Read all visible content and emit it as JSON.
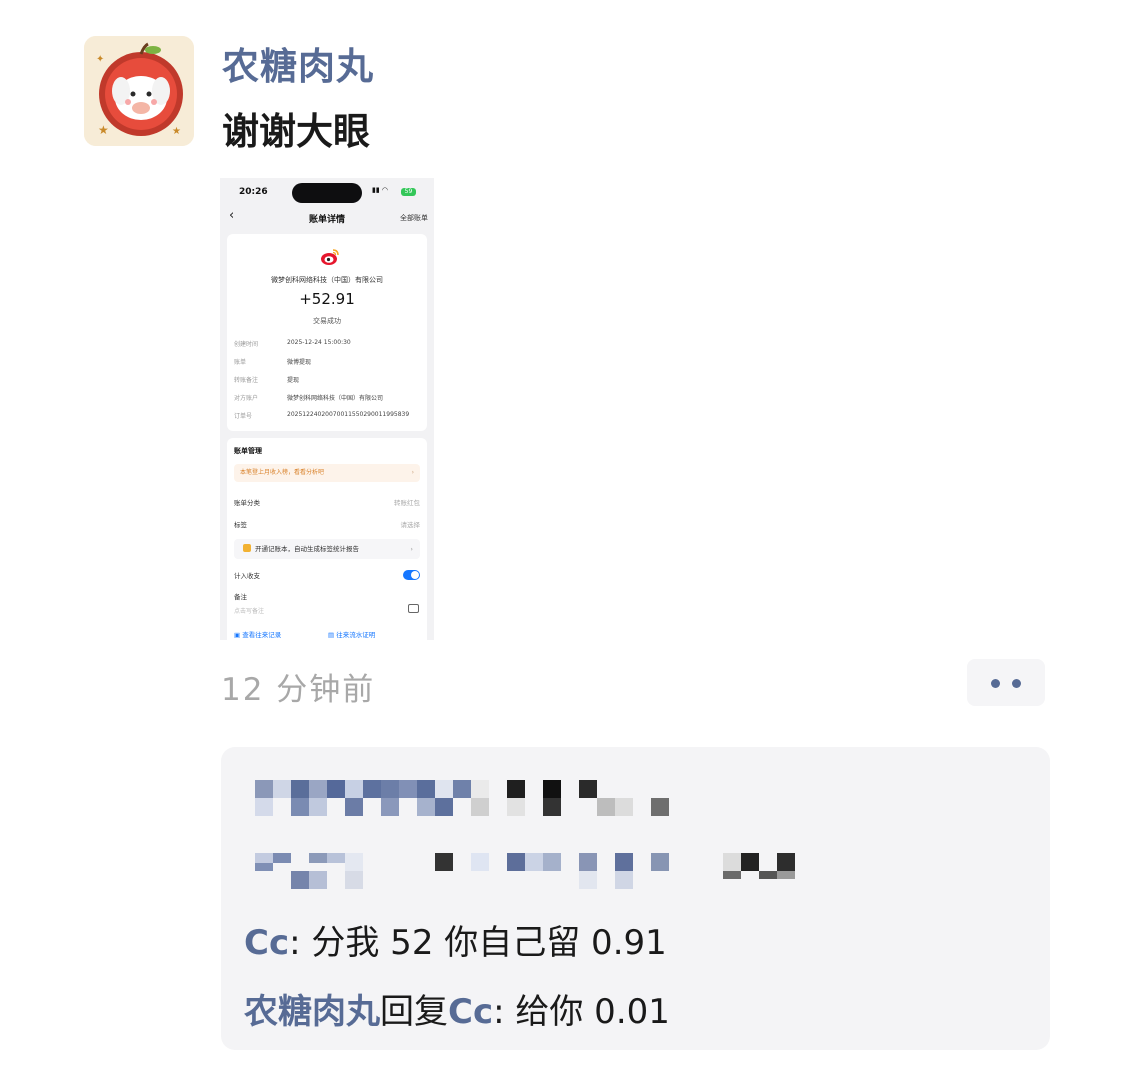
{
  "post": {
    "author": "农糖肉丸",
    "text": "谢谢大眼",
    "time": "12 分钟前"
  },
  "screenshot": {
    "status_time": "20:26",
    "battery": "59",
    "title": "账单详情",
    "right_link": "全部账单",
    "company": "微梦创科网络科技（中国）有限公司",
    "amount": "+52.91",
    "status": "交易成功",
    "details": [
      {
        "label": "创建时间",
        "value": "2025-12-24 15:00:30"
      },
      {
        "label": "账单",
        "value": "微博提现"
      },
      {
        "label": "转账备注",
        "value": "提现"
      },
      {
        "label": "对方账户",
        "value": "微梦创科网络科技（中国）有限公司"
      },
      {
        "label": "订单号",
        "value": "20251224020070011550290011995839"
      }
    ],
    "manage_title": "账单管理",
    "tip": "本笔登上月收入榜，看看分析吧",
    "category_label": "账单分类",
    "category_value": "转账红包",
    "tag_label": "标签",
    "tag_value": "请选择",
    "banner": "开通记账本，自动生成标签统计报告",
    "include_label": "计入收支",
    "note_label": "备注",
    "note_placeholder": "点击写备注",
    "link_history": "查看往来记录",
    "link_proof": "往来流水证明"
  },
  "comments": [
    {
      "name": "Cc",
      "sep": ": ",
      "text": "分我 52  你自己留 0.91"
    },
    {
      "name": "农糖肉丸",
      "reply": "回复",
      "to": "Cc",
      "sep": ": ",
      "text": "给你 0.01"
    }
  ],
  "colors": {
    "name_blue": "#576b95",
    "comment_bg": "#f4f4f6",
    "time_gray": "#a8a8a8"
  }
}
